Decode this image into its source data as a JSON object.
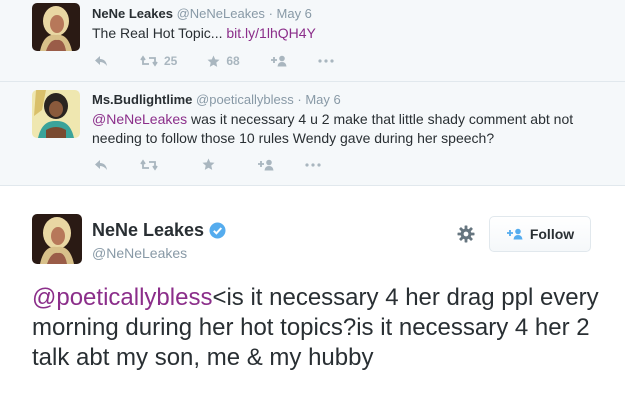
{
  "tweets": [
    {
      "name": "NeNe Leakes",
      "handle": "@NeNeLeakes",
      "date": "· May 6",
      "text": "The Real Hot Topic... ",
      "link": "bit.ly/1lhQH4Y",
      "retweets": "25",
      "favorites": "68",
      "avatar_icon": "profile-photo"
    },
    {
      "name": "Ms.Budlightlime",
      "handle": "@poeticallybless",
      "date": "· May 6",
      "mention": "@NeNeLeakes",
      "text": " was it necessary 4 u 2 make that little shady comment abt not needing to follow those 10 rules Wendy gave during her speech?",
      "avatar_icon": "profile-photo"
    }
  ],
  "main_tweet": {
    "name": "NeNe Leakes",
    "handle": "@NeNeLeakes",
    "verified_icon": "verified-badge",
    "follow_label": "Follow",
    "mention": "@poeticallybless",
    "text": "<is it necessary 4 her drag ppl every morning during her hot topics?is it necessary 4 her 2 talk abt my son, me & my hubby"
  },
  "icons": {
    "reply": "reply-arrow",
    "retweet": "retweet-arrows",
    "favorite": "star",
    "follow_user": "add-user",
    "more": "ellipsis",
    "settings": "gear"
  },
  "colors": {
    "link": "#8b2e8a",
    "verified": "#55acee",
    "muted": "#8899a6",
    "context_bg": "#f5f8fa"
  }
}
